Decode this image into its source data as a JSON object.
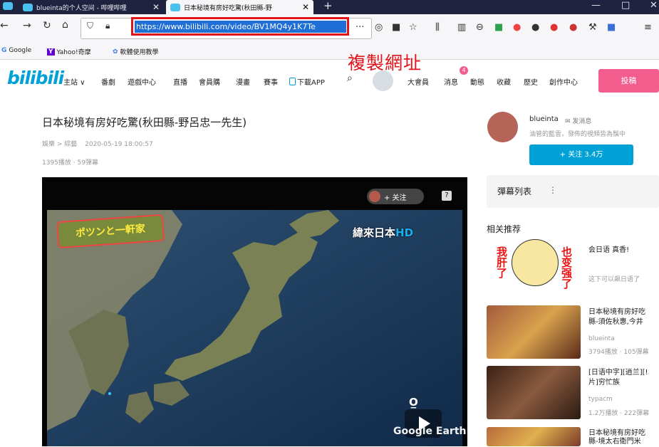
{
  "browser": {
    "tabs": [
      {
        "title": "blueinta的个人空间 - 哔哩哔哩"
      },
      {
        "title": "日本秘境有房好吃驚(秋田縣-野"
      }
    ],
    "new_tab": "+",
    "window_controls": [
      "—",
      "□",
      "✕"
    ],
    "url": "https://www.bilibili.com/video/BV1MQ4y1K7Te",
    "bookmarks": [
      "Google",
      "Yahoo!奇摩",
      "軟體使用教學"
    ]
  },
  "annotation": {
    "text": "複製網址"
  },
  "site": {
    "logo": "bilibili",
    "nav_left": [
      "主站",
      "番劇",
      "遊戲中心",
      "直播",
      "會員購",
      "漫畫",
      "賽事"
    ],
    "download_app": "下載APP",
    "nav_right": [
      "大會員",
      "消息",
      "動態",
      "收藏",
      "歷史",
      "創作中心"
    ],
    "notification_count": "4",
    "post_button": "投稿"
  },
  "video": {
    "title": "日本秘境有房好吃驚(秋田縣-野呂忠一先生)",
    "category": "娛樂 > 綜藝",
    "date": "2020-05-19 18:00:57",
    "stats": "1395播放 · 59彈幕",
    "follow_overlay": "+ 关注",
    "channel_prefix": "緯來日本",
    "channel_suffix": "HD",
    "show_logo": "ポツンと一軒家",
    "earth_text": "Google Earth",
    "player_button": "?"
  },
  "uploader": {
    "name": "blueinta",
    "msg_button": "发消息",
    "description": "油管的藍雲，發佈的視頻皆為鬚中",
    "follow_button": "+ 关注 3.4万"
  },
  "danmaku": {
    "label": "彈幕列表",
    "icon": "⋮"
  },
  "related": {
    "heading": "相关推荐",
    "items": [
      {
        "title": "会日语 真香!",
        "subtitle": "这下可以飙日语了"
      },
      {
        "title_line1": "日本秘境有房好吃",
        "title_line2": "縣-須佐秋惠,今井",
        "uploader": "blueinta",
        "stats": "3794播放 · 105彈幕"
      },
      {
        "title_line1": "[日语中字][逍兰][!",
        "title_line2": "片]穷忙族",
        "uploader": "typacm",
        "stats": "1.2万播放 · 222彈幕"
      },
      {
        "title_line1": "日本秘境有房好吃",
        "title_line2": "縣-境太右衛門米"
      }
    ]
  },
  "meme": {
    "left": "我肝了",
    "right": "也变强了"
  },
  "colors": {
    "accent": "#00a1d6",
    "pink": "#f25d8e",
    "highlight": "#e1141c",
    "tabbar": "#202340"
  }
}
